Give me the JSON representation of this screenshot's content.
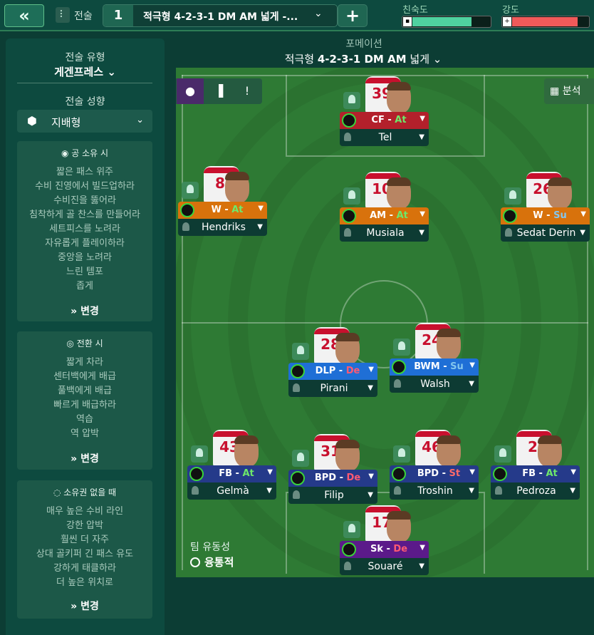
{
  "header": {
    "back_label": "«",
    "tactic_label": "전술",
    "slot_number": "1",
    "tactic_name": "적극형 4-2-3-1 DM AM 넓게 -...",
    "add_label": "+",
    "familiarity_label": "친숙도",
    "familiarity_level": 0.75,
    "intensity_label": "강도",
    "intensity_level": 0.85
  },
  "sidebar": {
    "style_title": "전술 유형",
    "style_value": "게겐프레스",
    "mentality_title": "전술 성향",
    "mentality_value": "지배형",
    "in_possession": {
      "title": "공 소유 시",
      "items": [
        "짧은 패스 위주",
        "수비 진영에서 빌드업하라",
        "수비진을 뚫어라",
        "침착하게 골 찬스를 만들어라",
        "세트피스를 노려라",
        "자유롭게 플레이하라",
        "중앙을 노려라",
        "느린 템포",
        "좁게"
      ],
      "change_label": "변경"
    },
    "in_transition": {
      "title": "전환 시",
      "items": [
        "짧게 차라",
        "센터백에게 배급",
        "풀백에게 배급",
        "빠르게 배급하라",
        "역습",
        "역 압박"
      ],
      "change_label": "변경"
    },
    "out_of_possession": {
      "title": "소유권 없을 때",
      "items": [
        "매우 높은 수비 라인",
        "강한 압박",
        "훨씬 더 자주",
        "상대 골키퍼 긴 패스 유도",
        "강하게 태클하라",
        "더 높은 위치로"
      ],
      "change_label": "변경"
    }
  },
  "formation": {
    "label": "포메이션",
    "name_prefix": "적극형",
    "name_bold": "4-2-3-1 DM AM",
    "name_suffix": "넓게"
  },
  "pitch": {
    "analysis_label": "분석",
    "fluidity_label": "팀 유동성",
    "fluidity_value": "융통적"
  },
  "players": [
    {
      "number": "39",
      "role": "CF",
      "duty": "At",
      "name": "Tel",
      "role_color": "#b3202b"
    },
    {
      "number": "8",
      "role": "W",
      "duty": "At",
      "name": "Hendriks",
      "role_color": "#d8720c"
    },
    {
      "number": "10",
      "role": "AM",
      "duty": "At",
      "name": "Musiala",
      "role_color": "#d8720c"
    },
    {
      "number": "26",
      "role": "W",
      "duty": "Su",
      "name": "Sedat Derin",
      "role_color": "#d8720c"
    },
    {
      "number": "28",
      "role": "DLP",
      "duty": "De",
      "name": "Pirani",
      "role_color": "#1f6fd6"
    },
    {
      "number": "24",
      "role": "BWM",
      "duty": "Su",
      "name": "Walsh",
      "role_color": "#1f6fd6"
    },
    {
      "number": "43",
      "role": "FB",
      "duty": "At",
      "name": "Gelmà",
      "role_color": "#253a8a"
    },
    {
      "number": "31",
      "role": "BPD",
      "duty": "De",
      "name": "Filip",
      "role_color": "#253a8a"
    },
    {
      "number": "46",
      "role": "BPD",
      "duty": "St",
      "name": "Troshin",
      "role_color": "#253a8a"
    },
    {
      "number": "2",
      "role": "FB",
      "duty": "At",
      "name": "Pedroza",
      "role_color": "#253a8a"
    },
    {
      "number": "17",
      "role": "Sk",
      "duty": "De",
      "name": "Souaré",
      "role_color": "#5b1a8a"
    }
  ]
}
